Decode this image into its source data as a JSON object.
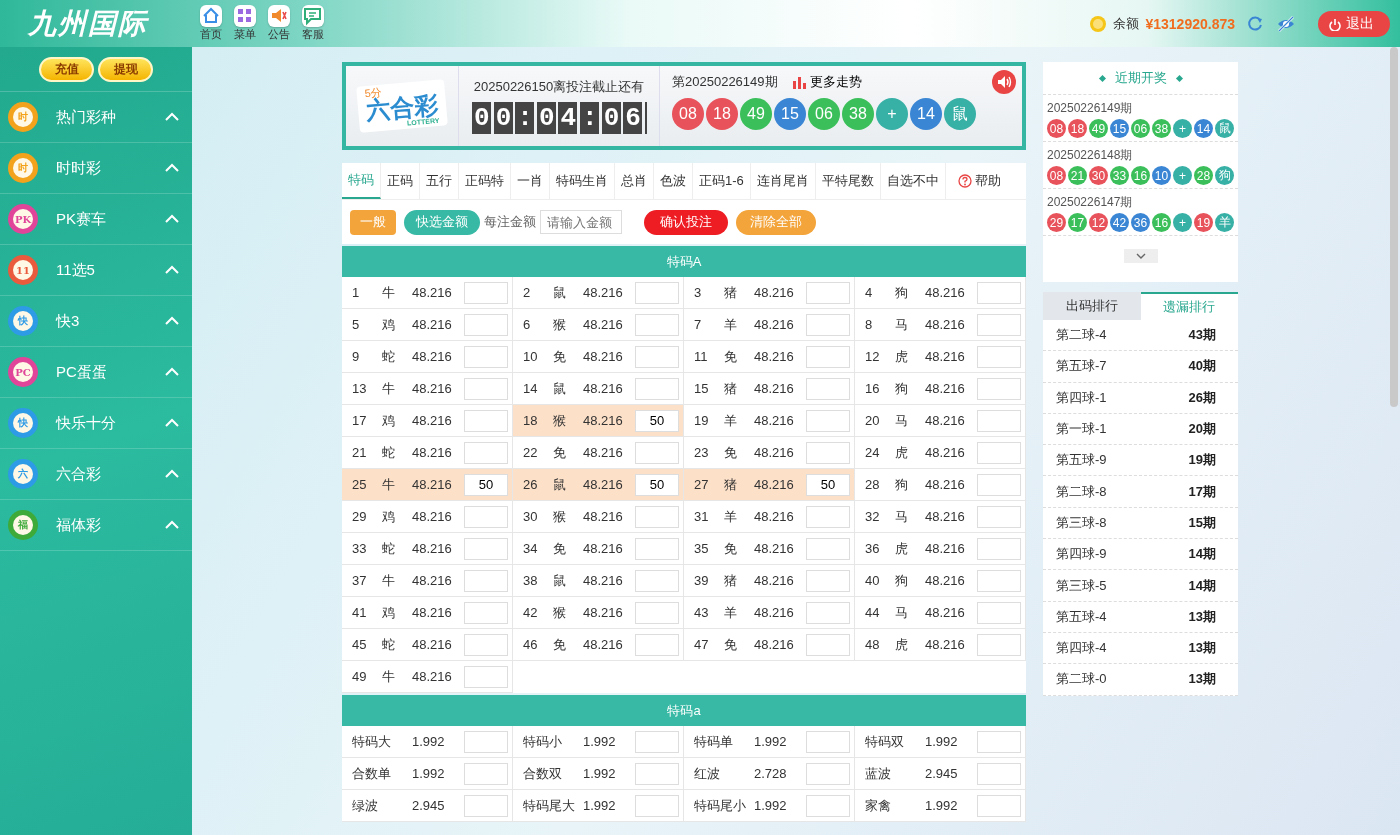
{
  "header": {
    "logo": "九州国际",
    "nav": [
      {
        "label": "首页",
        "kind": "home"
      },
      {
        "label": "菜单",
        "kind": "grid"
      },
      {
        "label": "公告",
        "kind": "speaker"
      },
      {
        "label": "客服",
        "kind": "chat"
      }
    ],
    "balance_label": "余额",
    "balance": "¥1312920.873",
    "logout": "退出"
  },
  "sidebar": {
    "buttons": [
      "充值",
      "提现"
    ],
    "items": [
      {
        "label": "热门彩种",
        "badge": "时",
        "color": "#f3a21c"
      },
      {
        "label": "时时彩",
        "badge": "时",
        "color": "#f3a21c"
      },
      {
        "label": "PK赛车",
        "badge": "PK",
        "color": "#e0459a"
      },
      {
        "label": "11选5",
        "badge": "11",
        "color": "#ea5a3c"
      },
      {
        "label": "快3",
        "badge": "快",
        "color": "#2e9be6"
      },
      {
        "label": "PC蛋蛋",
        "badge": "PC",
        "color": "#e0459a"
      },
      {
        "label": "快乐十分",
        "badge": "快",
        "color": "#2e9be6"
      },
      {
        "label": "六合彩",
        "badge": "六",
        "color": "#2e9be6"
      },
      {
        "label": "福体彩",
        "badge": "福",
        "color": "#3daa3a"
      }
    ]
  },
  "game": {
    "logo_top": "5分",
    "logo": "六合彩",
    "logo_sub": "LOTTERY",
    "countdown_label": "20250226150离投注截止还有",
    "countdown": "00:04:06",
    "period": "第20250226149期",
    "trend": "更多走势",
    "balls": [
      {
        "text": "08",
        "color": "#e8525a"
      },
      {
        "text": "18",
        "color": "#e8525a"
      },
      {
        "text": "49",
        "color": "#3bbf5a"
      },
      {
        "text": "15",
        "color": "#3a86d4"
      },
      {
        "text": "06",
        "color": "#3bbf5a"
      },
      {
        "text": "38",
        "color": "#3bbf5a"
      },
      {
        "text": "+",
        "color": "#37b0a6"
      },
      {
        "text": "14",
        "color": "#3a86d4"
      },
      {
        "text": "鼠",
        "color": "#37b0a6"
      }
    ]
  },
  "tabs": [
    {
      "label": "特码",
      "selected": true
    },
    {
      "label": "正码",
      "selected": false
    },
    {
      "label": "五行",
      "selected": false
    },
    {
      "label": "正码特",
      "selected": false
    },
    {
      "label": "一肖",
      "selected": false
    },
    {
      "label": "特码生肖",
      "selected": false
    },
    {
      "label": "总肖",
      "selected": false
    },
    {
      "label": "色波",
      "selected": false
    },
    {
      "label": "正码1-6",
      "selected": false
    },
    {
      "label": "连肖尾肖",
      "selected": false
    },
    {
      "label": "平特尾数",
      "selected": false
    },
    {
      "label": "自选不中",
      "selected": false
    }
  ],
  "help": "帮助",
  "actions": {
    "general": "一般",
    "quick": "快选金额",
    "per_bet_label": "每注金额",
    "amount_placeholder": "请输入金额",
    "confirm": "确认投注",
    "clear": "清除全部"
  },
  "sections": [
    {
      "title": "特码A",
      "kind": "numbers",
      "cells": [
        {
          "num": "1",
          "zodiac": "牛",
          "odds": "48.216",
          "selected": false
        },
        {
          "num": "2",
          "zodiac": "鼠",
          "odds": "48.216",
          "selected": false
        },
        {
          "num": "3",
          "zodiac": "猪",
          "odds": "48.216",
          "selected": false
        },
        {
          "num": "4",
          "zodiac": "狗",
          "odds": "48.216",
          "selected": false
        },
        {
          "num": "5",
          "zodiac": "鸡",
          "odds": "48.216",
          "selected": false
        },
        {
          "num": "6",
          "zodiac": "猴",
          "odds": "48.216",
          "selected": false
        },
        {
          "num": "7",
          "zodiac": "羊",
          "odds": "48.216",
          "selected": false
        },
        {
          "num": "8",
          "zodiac": "马",
          "odds": "48.216",
          "selected": false
        },
        {
          "num": "9",
          "zodiac": "蛇",
          "odds": "48.216",
          "selected": false
        },
        {
          "num": "10",
          "zodiac": "免",
          "odds": "48.216",
          "selected": false
        },
        {
          "num": "11",
          "zodiac": "免",
          "odds": "48.216",
          "selected": false
        },
        {
          "num": "12",
          "zodiac": "虎",
          "odds": "48.216",
          "selected": false
        },
        {
          "num": "13",
          "zodiac": "牛",
          "odds": "48.216",
          "selected": false
        },
        {
          "num": "14",
          "zodiac": "鼠",
          "odds": "48.216",
          "selected": false
        },
        {
          "num": "15",
          "zodiac": "猪",
          "odds": "48.216",
          "selected": false
        },
        {
          "num": "16",
          "zodiac": "狗",
          "odds": "48.216",
          "selected": false
        },
        {
          "num": "17",
          "zodiac": "鸡",
          "odds": "48.216",
          "selected": false
        },
        {
          "num": "18",
          "zodiac": "猴",
          "odds": "48.216",
          "amount": "50",
          "selected": true
        },
        {
          "num": "19",
          "zodiac": "羊",
          "odds": "48.216",
          "selected": false
        },
        {
          "num": "20",
          "zodiac": "马",
          "odds": "48.216",
          "selected": false
        },
        {
          "num": "21",
          "zodiac": "蛇",
          "odds": "48.216",
          "selected": false
        },
        {
          "num": "22",
          "zodiac": "免",
          "odds": "48.216",
          "selected": false
        },
        {
          "num": "23",
          "zodiac": "免",
          "odds": "48.216",
          "selected": false
        },
        {
          "num": "24",
          "zodiac": "虎",
          "odds": "48.216",
          "selected": false
        },
        {
          "num": "25",
          "zodiac": "牛",
          "odds": "48.216",
          "amount": "50",
          "selected": true
        },
        {
          "num": "26",
          "zodiac": "鼠",
          "odds": "48.216",
          "amount": "50",
          "selected": true
        },
        {
          "num": "27",
          "zodiac": "猪",
          "odds": "48.216",
          "amount": "50",
          "selected": true
        },
        {
          "num": "28",
          "zodiac": "狗",
          "odds": "48.216",
          "selected": false
        },
        {
          "num": "29",
          "zodiac": "鸡",
          "odds": "48.216",
          "selected": false
        },
        {
          "num": "30",
          "zodiac": "猴",
          "odds": "48.216",
          "selected": false
        },
        {
          "num": "31",
          "zodiac": "羊",
          "odds": "48.216",
          "selected": false
        },
        {
          "num": "32",
          "zodiac": "马",
          "odds": "48.216",
          "selected": false
        },
        {
          "num": "33",
          "zodiac": "蛇",
          "odds": "48.216",
          "selected": false
        },
        {
          "num": "34",
          "zodiac": "免",
          "odds": "48.216",
          "selected": false
        },
        {
          "num": "35",
          "zodiac": "免",
          "odds": "48.216",
          "selected": false
        },
        {
          "num": "36",
          "zodiac": "虎",
          "odds": "48.216",
          "selected": false
        },
        {
          "num": "37",
          "zodiac": "牛",
          "odds": "48.216",
          "selected": false
        },
        {
          "num": "38",
          "zodiac": "鼠",
          "odds": "48.216",
          "selected": false
        },
        {
          "num": "39",
          "zodiac": "猪",
          "odds": "48.216",
          "selected": false
        },
        {
          "num": "40",
          "zodiac": "狗",
          "odds": "48.216",
          "selected": false
        },
        {
          "num": "41",
          "zodiac": "鸡",
          "odds": "48.216",
          "selected": false
        },
        {
          "num": "42",
          "zodiac": "猴",
          "odds": "48.216",
          "selected": false
        },
        {
          "num": "43",
          "zodiac": "羊",
          "odds": "48.216",
          "selected": false
        },
        {
          "num": "44",
          "zodiac": "马",
          "odds": "48.216",
          "selected": false
        },
        {
          "num": "45",
          "zodiac": "蛇",
          "odds": "48.216",
          "selected": false
        },
        {
          "num": "46",
          "zodiac": "免",
          "odds": "48.216",
          "selected": false
        },
        {
          "num": "47",
          "zodiac": "免",
          "odds": "48.216",
          "selected": false
        },
        {
          "num": "48",
          "zodiac": "虎",
          "odds": "48.216",
          "selected": false
        },
        {
          "num": "49",
          "zodiac": "牛",
          "odds": "48.216",
          "selected": false
        }
      ]
    },
    {
      "title": "特码a",
      "kind": "named",
      "cells": [
        {
          "name": "特码大",
          "odds": "1.992",
          "selected": false
        },
        {
          "name": "特码小",
          "odds": "1.992",
          "selected": false
        },
        {
          "name": "特码单",
          "odds": "1.992",
          "selected": false
        },
        {
          "name": "特码双",
          "odds": "1.992",
          "selected": false
        },
        {
          "name": "合数单",
          "odds": "1.992",
          "selected": false
        },
        {
          "name": "合数双",
          "odds": "1.992",
          "selected": false
        },
        {
          "name": "红波",
          "odds": "2.728",
          "selected": false
        },
        {
          "name": "蓝波",
          "odds": "2.945",
          "selected": false
        },
        {
          "name": "绿波",
          "odds": "2.945",
          "selected": false
        },
        {
          "name": "特码尾大",
          "odds": "1.992",
          "selected": false
        },
        {
          "name": "特码尾小",
          "odds": "1.992",
          "selected": false
        },
        {
          "name": "家禽",
          "odds": "1.992",
          "selected": false
        }
      ]
    }
  ],
  "recent": {
    "title": "近期开奖",
    "draws": [
      {
        "period": "20250226149期",
        "balls": [
          {
            "text": "08",
            "color": "#e8525a"
          },
          {
            "text": "18",
            "color": "#e8525a"
          },
          {
            "text": "49",
            "color": "#3bbf5a"
          },
          {
            "text": "15",
            "color": "#3a86d4"
          },
          {
            "text": "06",
            "color": "#3bbf5a"
          },
          {
            "text": "38",
            "color": "#3bbf5a"
          },
          {
            "text": "+",
            "color": "#37b0a6"
          },
          {
            "text": "14",
            "color": "#3a86d4"
          },
          {
            "text": "鼠",
            "color": "#37b0a6"
          }
        ]
      },
      {
        "period": "20250226148期",
        "balls": [
          {
            "text": "08",
            "color": "#e8525a"
          },
          {
            "text": "21",
            "color": "#3bbf5a"
          },
          {
            "text": "30",
            "color": "#e8525a"
          },
          {
            "text": "33",
            "color": "#3bbf5a"
          },
          {
            "text": "16",
            "color": "#3bbf5a"
          },
          {
            "text": "10",
            "color": "#3a86d4"
          },
          {
            "text": "+",
            "color": "#37b0a6"
          },
          {
            "text": "28",
            "color": "#3bbf5a"
          },
          {
            "text": "狗",
            "color": "#37b0a6"
          }
        ]
      },
      {
        "period": "20250226147期",
        "balls": [
          {
            "text": "29",
            "color": "#e8525a"
          },
          {
            "text": "17",
            "color": "#3bbf5a"
          },
          {
            "text": "12",
            "color": "#e8525a"
          },
          {
            "text": "42",
            "color": "#3a86d4"
          },
          {
            "text": "36",
            "color": "#3a86d4"
          },
          {
            "text": "16",
            "color": "#3bbf5a"
          },
          {
            "text": "+",
            "color": "#37b0a6"
          },
          {
            "text": "19",
            "color": "#e8525a"
          },
          {
            "text": "羊",
            "color": "#37b0a6"
          }
        ]
      }
    ]
  },
  "ranking": {
    "tabs": [
      {
        "label": "出码排行",
        "selected": false
      },
      {
        "label": "遗漏排行",
        "selected": true
      }
    ],
    "rows": [
      {
        "name": "第二球-4",
        "count": "43期"
      },
      {
        "name": "第五球-7",
        "count": "40期"
      },
      {
        "name": "第四球-1",
        "count": "26期"
      },
      {
        "name": "第一球-1",
        "count": "20期"
      },
      {
        "name": "第五球-9",
        "count": "19期"
      },
      {
        "name": "第二球-8",
        "count": "17期"
      },
      {
        "name": "第三球-8",
        "count": "15期"
      },
      {
        "name": "第四球-9",
        "count": "14期"
      },
      {
        "name": "第三球-5",
        "count": "14期"
      },
      {
        "name": "第五球-4",
        "count": "13期"
      },
      {
        "name": "第四球-4",
        "count": "13期"
      },
      {
        "name": "第二球-0",
        "count": "13期"
      }
    ]
  }
}
